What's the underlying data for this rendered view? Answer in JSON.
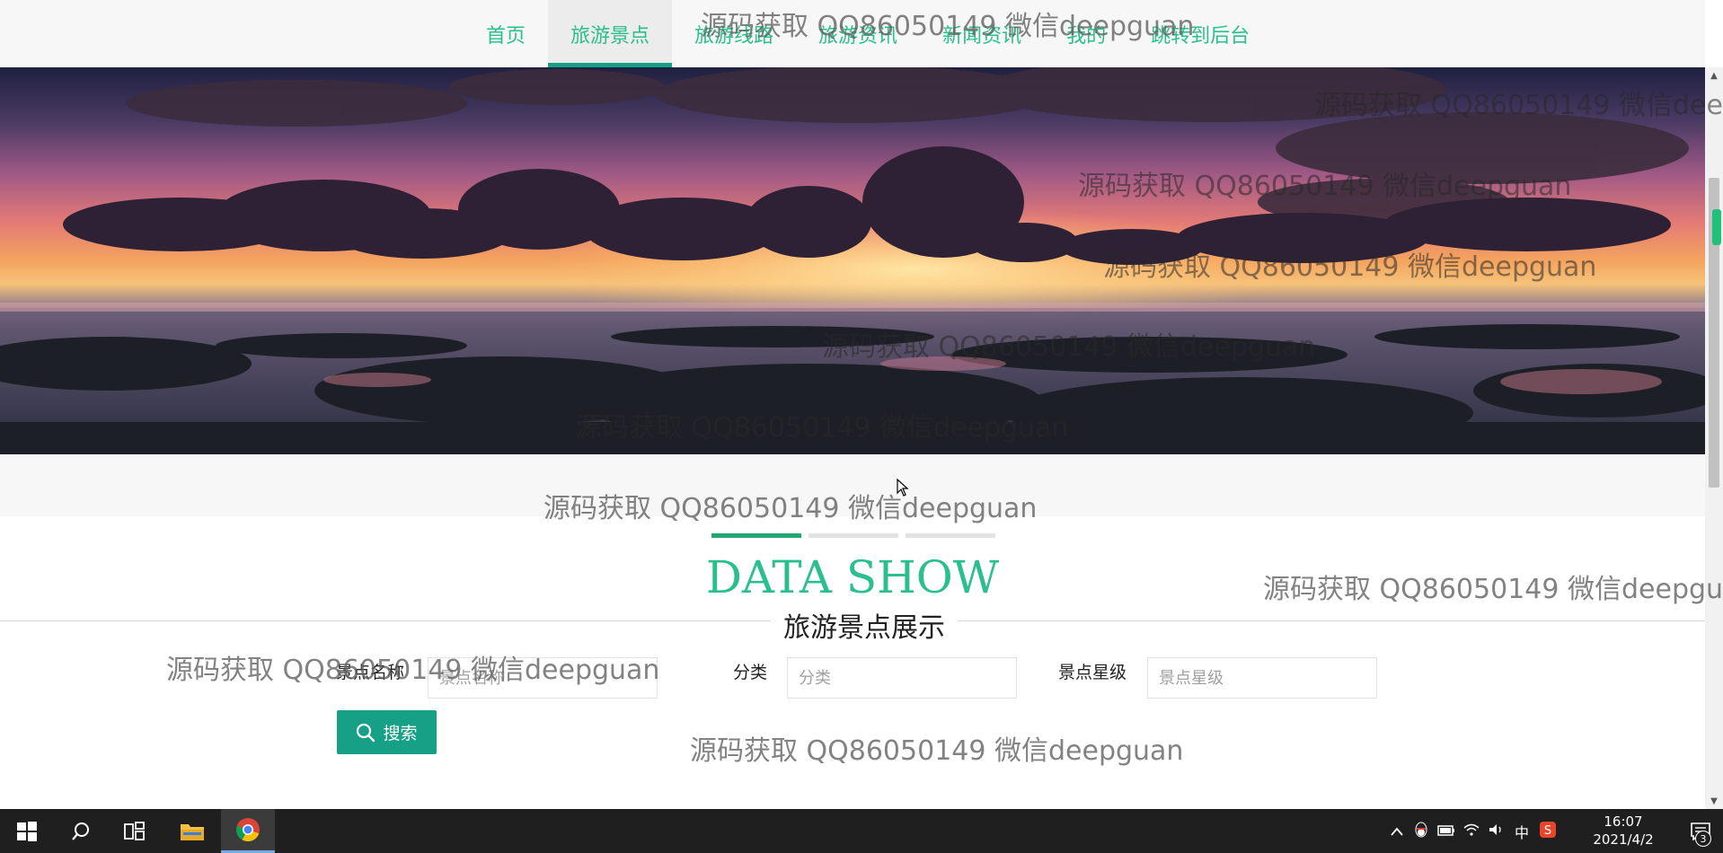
{
  "nav": {
    "items": [
      {
        "label": "首页",
        "active": false
      },
      {
        "label": "旅游景点",
        "active": true
      },
      {
        "label": "旅游线路",
        "active": false
      },
      {
        "label": "旅游资讯",
        "active": false
      },
      {
        "label": "新闻资讯",
        "active": false
      },
      {
        "label": "我的",
        "active": false
      },
      {
        "label": "跳转到后台",
        "active": false
      }
    ]
  },
  "section": {
    "title_en": "DATA SHOW",
    "title_zh": "旅游景点展示"
  },
  "search": {
    "name_label": "景点名称",
    "name_placeholder": "景点名称",
    "category_label": "分类",
    "category_placeholder": "分类",
    "star_label": "景点星级",
    "star_placeholder": "景点星级",
    "button_label": "搜索"
  },
  "watermark": "源码获取 QQ86050149 微信deepguan",
  "taskbar": {
    "time": "16:07",
    "date": "2021/4/2",
    "ime": "中",
    "notification_count": "3"
  },
  "colors": {
    "accent": "#2bbf8e",
    "button": "#16a085",
    "taskbar": "#1f1f1f"
  }
}
